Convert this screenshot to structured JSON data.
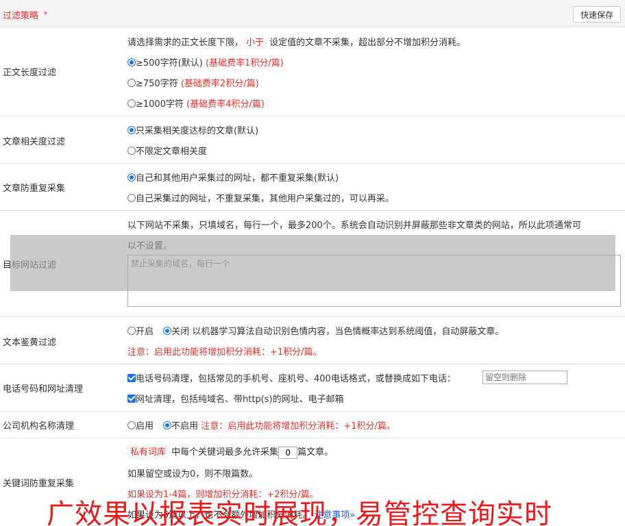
{
  "header": {
    "title": "过滤策略",
    "chevron": "»",
    "save_label": "快速保存"
  },
  "length_filter": {
    "label": "正文长度过滤",
    "desc_pre": "请选择需求的正文长度下限，",
    "desc_hl": "小于",
    "desc_post": "设定值的文章不采集，超出部分不增加积分消耗。",
    "options": [
      {
        "text": "≥500字符(默认)",
        "note": "(基础费率1积分/篇)",
        "checked": true
      },
      {
        "text": "≥750字符",
        "note": "(基础费率2积分/篇)",
        "checked": false
      },
      {
        "text": "≥1000字符",
        "note": "(基础费率4积分/篇)",
        "checked": false
      }
    ]
  },
  "relevance": {
    "label": "文章相关度过滤",
    "options": [
      {
        "text": "只采集相关度达标的文章(默认)",
        "checked": true
      },
      {
        "text": "不限定文章相关度",
        "checked": false
      }
    ]
  },
  "dedupe": {
    "label": "文章防重复采集",
    "options": [
      {
        "text": "自己和其他用户采集过的网址，都不重复采集(默认)",
        "checked": true
      },
      {
        "text": "自己采集过的网址，不重复采集，其他用户采集过的，可以再采。",
        "checked": false
      }
    ]
  },
  "site_filter": {
    "label": "目标网站过滤",
    "desc_line1": "以下网站不采集，只填域名，每行一个，最多200个。系统会自动识别并屏蔽那些非文章类的网站，所以此项通常可",
    "desc_line2": "以不设置。",
    "placeholder": "禁止采集的域名，每行一个"
  },
  "porn_filter": {
    "label": "文本鉴黄过滤",
    "on_label": "开启",
    "off_label": "关闭",
    "selected": "关闭",
    "desc": "以机器学习算法自动识别色情内容，当色情概率达到系统阈值，自动屏蔽文章。",
    "note": "注意：启用此功能将增加积分消耗：+1积分/篇。"
  },
  "phone_clean": {
    "label": "电话号码和网址清理",
    "phone_text": "电话号码清理，包括常见的手机号、座机号、400电话格式，或替换成如下电话：",
    "phone_placeholder": "留空则删除",
    "url_text": "网址清理，包括纯域名、带http(s)的网址、电子邮箱"
  },
  "company_clean": {
    "label": "公司机构名称清理",
    "on_label": "启用",
    "off_label": "不启用",
    "selected": "不启用",
    "note": "注意：启用此功能将增加积分消耗：+1积分/篇。"
  },
  "keyword_dedupe": {
    "label": "关键词防重复采集",
    "line1_hl": "私有词库",
    "line1_pre": "中每个关键词最多允许采集",
    "count_value": "0",
    "line1_post": "篇文章。",
    "line2": "如果留空或设为0，则不限篇数。",
    "line3": "如果设为1-4篇，则增加积分消耗：+2积分/篇。",
    "line4_partial": "如果设为5篇以上，也不会额外增加积分消耗。",
    "notice_link": "注意事项»"
  },
  "banner_text": "广效果以报表实时展现，易管控查询实时",
  "colors": {
    "accent_red": "#e5322d",
    "radio_blue": "#1a73e8",
    "banner_red": "#e81a1a",
    "link_blue": "#1a5fd0"
  }
}
